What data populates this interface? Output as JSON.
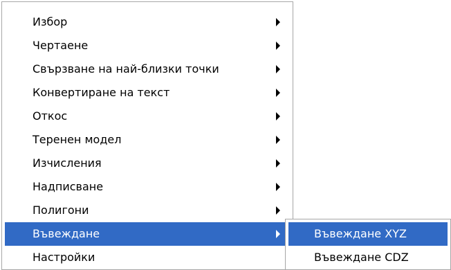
{
  "main_menu": {
    "items": [
      {
        "label": "Избор",
        "has_submenu": true
      },
      {
        "label": "Чертаене",
        "has_submenu": true
      },
      {
        "label": "Свързване на най-близки точки",
        "has_submenu": true
      },
      {
        "label": "Конвертиране на текст",
        "has_submenu": true
      },
      {
        "label": "Откос",
        "has_submenu": true
      },
      {
        "label": "Теренен модел",
        "has_submenu": true
      },
      {
        "label": "Изчисления",
        "has_submenu": true
      },
      {
        "label": "Надписване",
        "has_submenu": true
      },
      {
        "label": "Полигони",
        "has_submenu": true
      },
      {
        "label": "Въвеждане",
        "has_submenu": true,
        "highlighted": true
      },
      {
        "label": "Настройки",
        "has_submenu": false
      }
    ]
  },
  "sub_menu": {
    "items": [
      {
        "label": "Въвеждане XYZ",
        "highlighted": true
      },
      {
        "label": "Въвеждане CDZ",
        "highlighted": false
      }
    ]
  },
  "colors": {
    "highlight": "#316ac5",
    "highlight_text": "#ffffff",
    "menu_border": "#a6a6a6"
  },
  "icons": {
    "submenu_arrow": "submenu-arrow-icon"
  }
}
